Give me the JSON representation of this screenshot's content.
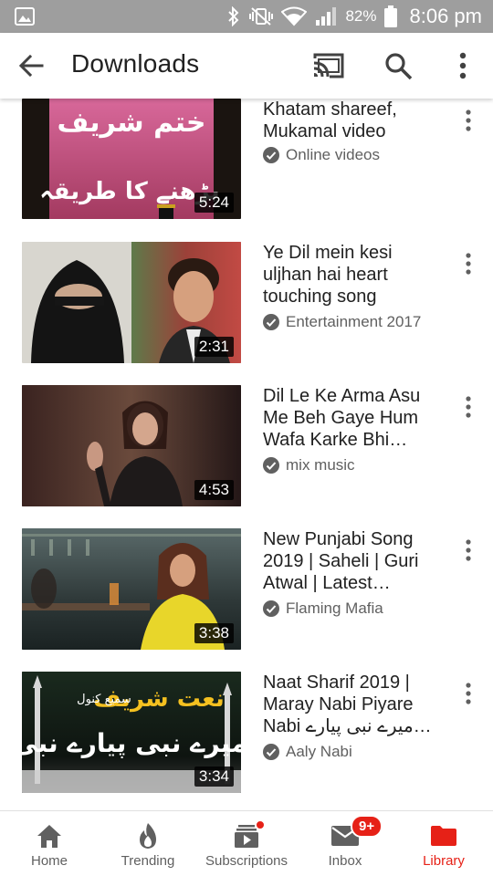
{
  "status_bar": {
    "battery": "82%",
    "time": "8:06 pm",
    "icons": [
      "image-icon",
      "bluetooth-icon",
      "vibrate-off-icon",
      "wifi-icon",
      "signal-icon",
      "battery-icon"
    ]
  },
  "app_bar": {
    "title": "Downloads",
    "icons": [
      "back-arrow-icon",
      "cast-icon",
      "search-icon",
      "more-vert-icon"
    ]
  },
  "videos": [
    {
      "title": "Khatam shareef, Mukamal video",
      "channel": "Online videos",
      "duration": "5:24",
      "overlay_text": [
        "ختم شریف",
        "پڑھنے کا طریقہ"
      ]
    },
    {
      "title": "Ye Dil mein kesi uljhan hai heart touching song",
      "channel": "Entertainment 2017",
      "duration": "2:31"
    },
    {
      "title": "Dil Le Ke Arma Asu Me Beh Gaye Hum Wafa Karke Bhi…",
      "channel": "mix music",
      "duration": "4:53"
    },
    {
      "title": "New Punjabi Song 2019 | Saheli | Guri Atwal | Latest…",
      "channel": "Flaming Mafia",
      "duration": "3:38"
    },
    {
      "title": "Naat Sharif 2019 | Maray Nabi Piyare Nabi میرے نبی پیارے…",
      "channel": "Aaly Nabi",
      "duration": "3:34",
      "overlay_text": [
        "نعت شریف",
        "سمیع کنول",
        "میرے نبی پیارے نبی"
      ]
    }
  ],
  "bottom_nav": [
    {
      "label": "Home",
      "icon": "home-icon"
    },
    {
      "label": "Trending",
      "icon": "flame-icon"
    },
    {
      "label": "Subscriptions",
      "icon": "subscriptions-icon",
      "dot_badge": true
    },
    {
      "label": "Inbox",
      "icon": "mail-icon",
      "badge": "9+"
    },
    {
      "label": "Library",
      "icon": "folder-icon",
      "active": true
    }
  ],
  "colors": {
    "accent_red": "#e62117",
    "status_bar": "#9e9e9e",
    "text_primary": "#212121",
    "text_secondary": "#606060"
  }
}
